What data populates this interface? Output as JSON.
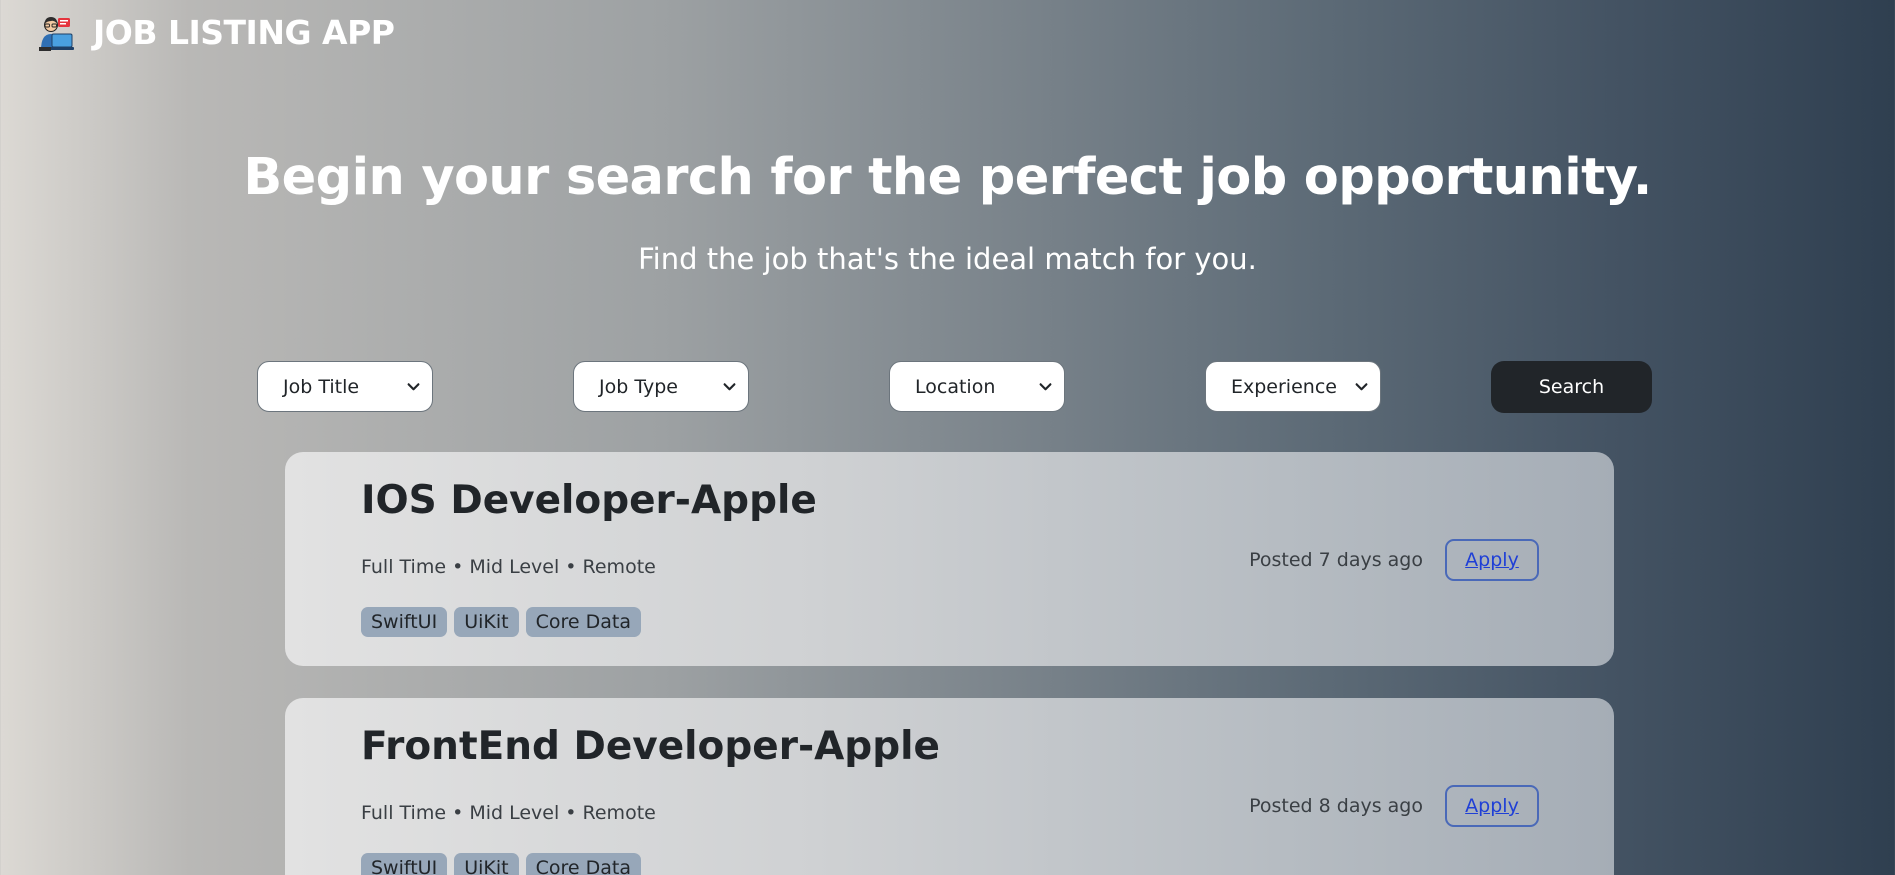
{
  "header": {
    "app_title": "JOB LISTING APP",
    "logo_icon": "developer-avatar-icon"
  },
  "hero": {
    "title": "Begin your search for the perfect job opportunity.",
    "subtitle": "Find the job that's the ideal match for you."
  },
  "filters": {
    "job_title": "Job Title",
    "job_type": "Job Type",
    "location": "Location",
    "experience": "Experience",
    "search_label": "Search"
  },
  "jobs": [
    {
      "title": "IOS Developer-Apple",
      "meta": "Full Time • Mid Level • Remote",
      "tags": [
        "SwiftUI",
        "UiKit",
        "Core Data"
      ],
      "posted": "Posted 7 days ago",
      "apply_label": "Apply"
    },
    {
      "title": "FrontEnd Developer-Apple",
      "meta": "Full Time • Mid Level • Remote",
      "tags": [
        "SwiftUI",
        "UiKit",
        "Core Data"
      ],
      "posted": "Posted 8 days ago",
      "apply_label": "Apply"
    }
  ],
  "colors": {
    "search_button": "#212529",
    "tag_background": "#97a7b9",
    "apply_border": "#4a69b8",
    "apply_text": "#1f3fd6"
  }
}
